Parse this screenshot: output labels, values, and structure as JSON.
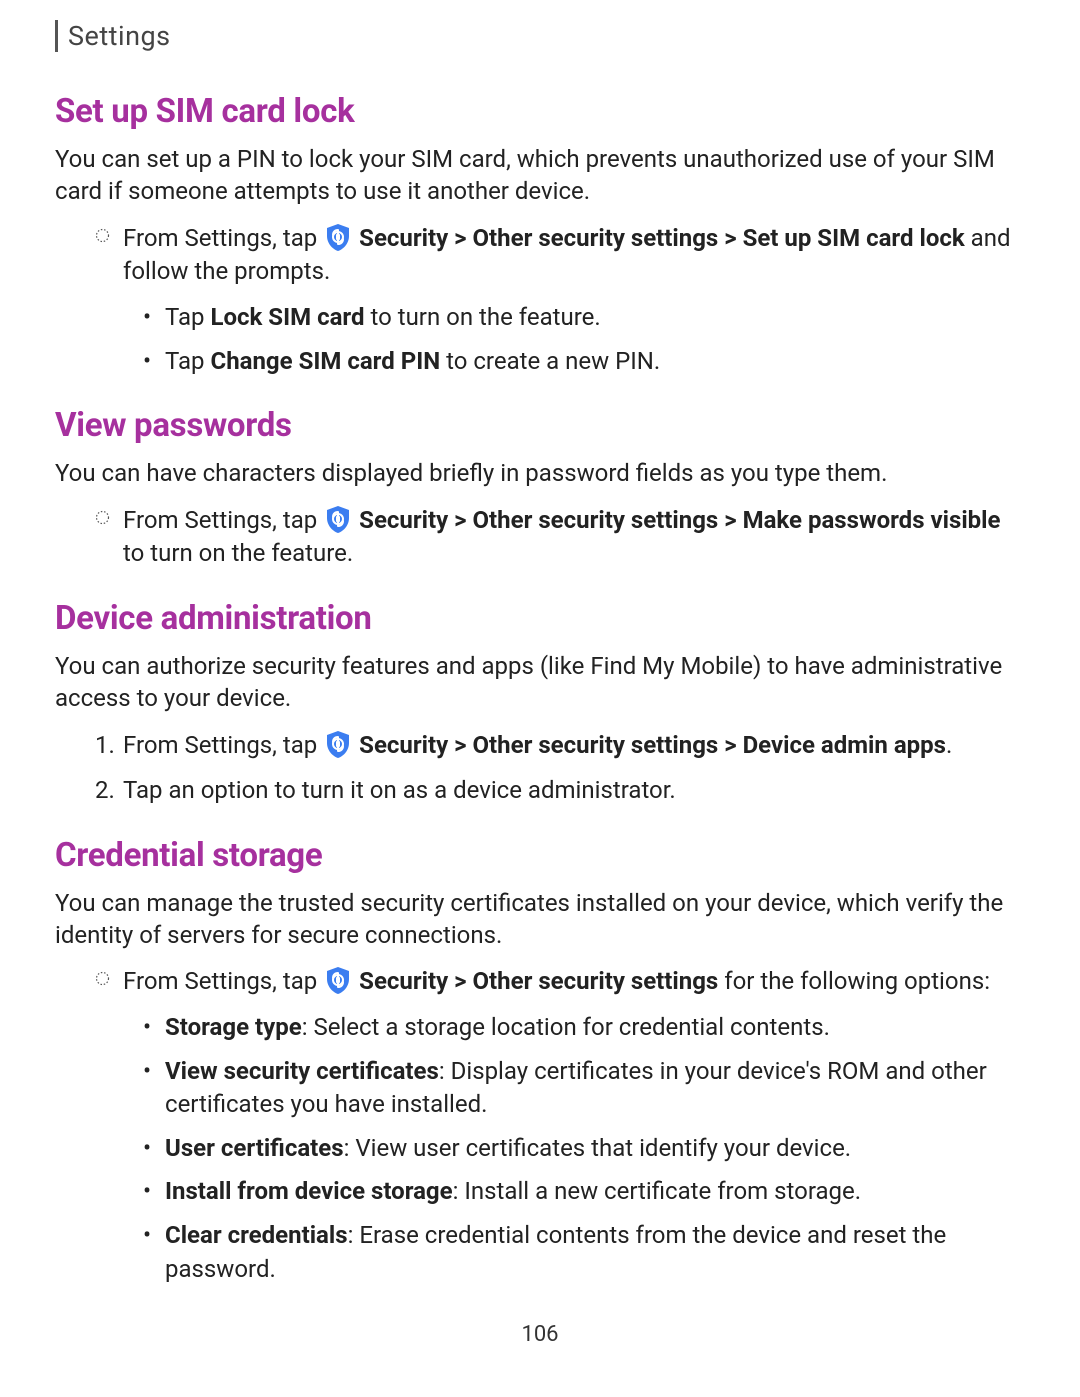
{
  "header": {
    "label": "Settings"
  },
  "page_number": "106",
  "sections": {
    "sim": {
      "heading": "Set up SIM card lock",
      "intro": "You can set up a PIN to lock your SIM card, which prevents unauthorized use of your SIM card if someone attempts to use it another device.",
      "step_prefix": "From Settings, tap ",
      "step_bold": " Security > Other security settings > Set up SIM card lock",
      "step_suffix": " and follow the prompts.",
      "sub1_pre": "Tap ",
      "sub1_bold": "Lock SIM card",
      "sub1_post": " to turn on the feature.",
      "sub2_pre": "Tap ",
      "sub2_bold": "Change SIM card PIN",
      "sub2_post": " to create a new PIN."
    },
    "view": {
      "heading": "View passwords",
      "intro": "You can have characters displayed briefly in password fields as you type them.",
      "step_prefix": "From Settings, tap ",
      "step_bold": " Security > Other security settings > Make passwords visible",
      "step_suffix": " to turn on the feature."
    },
    "device": {
      "heading": "Device administration",
      "intro": "You can authorize security features and apps (like Find My Mobile) to have administrative access to your device.",
      "step1_num": "1.",
      "step1_pre": "From Settings, tap ",
      "step1_bold": " Security > Other security settings > Device admin apps",
      "step1_post": ".",
      "step2_num": "2.",
      "step2": "Tap an option to turn it on as a device administrator."
    },
    "cred": {
      "heading": "Credential storage",
      "intro": "You can manage the trusted security certificates installed on your device, which verify the identity of servers for secure connections.",
      "step_prefix": "From Settings, tap ",
      "step_bold": " Security > Other security settings",
      "step_suffix": " for the following options:",
      "opt1_bold": "Storage type",
      "opt1_post": ": Select a storage location for credential contents.",
      "opt2_bold": "View security certificates",
      "opt2_post": ": Display certificates in your device's ROM and other certificates you have installed.",
      "opt3_bold": "User certificates",
      "opt3_post": ": View user certificates that identify your device.",
      "opt4_bold": "Install from device storage",
      "opt4_post": ": Install a new certificate from storage.",
      "opt5_bold": "Clear credentials",
      "opt5_post": ": Erase credential contents from the device and reset the password."
    }
  }
}
